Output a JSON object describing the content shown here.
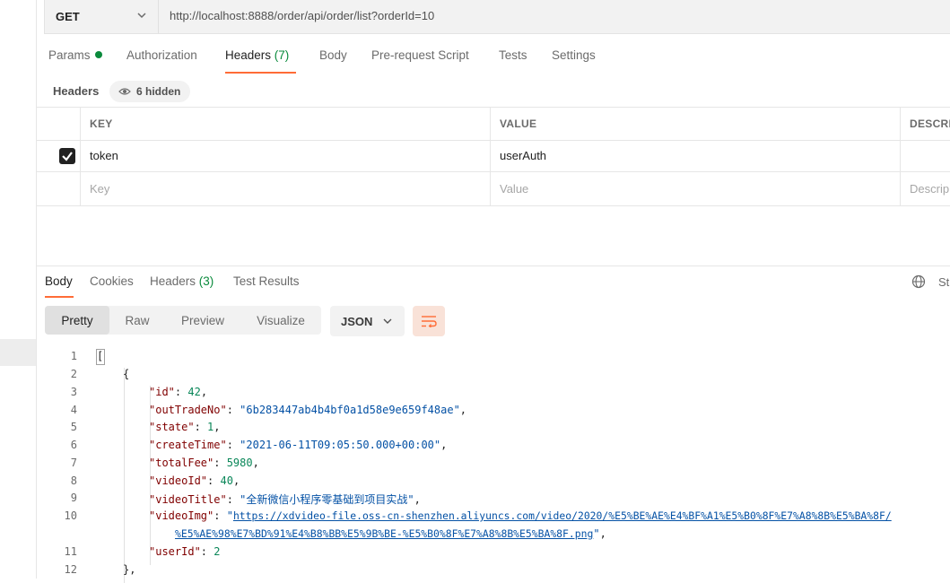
{
  "request": {
    "method": "GET",
    "url": "http://localhost:8888/order/api/order/list?orderId=10"
  },
  "request_tabs": [
    {
      "label": "Params",
      "count": ""
    },
    {
      "label": "Authorization",
      "count": ""
    },
    {
      "label": "Headers",
      "count": "(7)"
    },
    {
      "label": "Body",
      "count": ""
    },
    {
      "label": "Pre-request Script",
      "count": ""
    },
    {
      "label": "Tests",
      "count": ""
    },
    {
      "label": "Settings",
      "count": ""
    }
  ],
  "headers_section": {
    "title": "Headers",
    "hidden_label": "6 hidden"
  },
  "headers_table": {
    "columns": [
      "KEY",
      "VALUE",
      "DESCRI"
    ],
    "rows": [
      {
        "checked": true,
        "key": "token",
        "value": "userAuth",
        "description": ""
      }
    ],
    "placeholders": {
      "key": "Key",
      "value": "Value",
      "description": "Descrip"
    }
  },
  "response_tabs": [
    {
      "label": "Body",
      "count": ""
    },
    {
      "label": "Cookies",
      "count": ""
    },
    {
      "label": "Headers",
      "count": "(3)"
    },
    {
      "label": "Test Results",
      "count": ""
    }
  ],
  "status_partial": "St",
  "view_modes": [
    "Pretty",
    "Raw",
    "Preview",
    "Visualize"
  ],
  "active_view_mode": "Pretty",
  "format": "JSON",
  "code_lines": [
    {
      "n": "1",
      "text": "["
    },
    {
      "n": "2",
      "text": "{"
    },
    {
      "n": "3",
      "key": "\"id\"",
      "value": "42",
      "vtype": "num",
      "comma": ","
    },
    {
      "n": "4",
      "key": "\"outTradeNo\"",
      "value": "\"6b283447ab4b4bf0a1d58e9e659f48ae\"",
      "vtype": "str",
      "comma": ","
    },
    {
      "n": "5",
      "key": "\"state\"",
      "value": "1",
      "vtype": "num",
      "comma": ","
    },
    {
      "n": "6",
      "key": "\"createTime\"",
      "value": "\"2021-06-11T09:05:50.000+00:00\"",
      "vtype": "str",
      "comma": ","
    },
    {
      "n": "7",
      "key": "\"totalFee\"",
      "value": "5980",
      "vtype": "num",
      "comma": ","
    },
    {
      "n": "8",
      "key": "\"videoId\"",
      "value": "40",
      "vtype": "num",
      "comma": ","
    },
    {
      "n": "9",
      "key": "\"videoTitle\"",
      "value": "\"全新微信小程序零基础到项目实战\"",
      "vtype": "str",
      "comma": ","
    },
    {
      "n": "10",
      "key": "\"videoImg\"",
      "value_prefix": "\"",
      "link_part1": "https://xdvideo-file.oss-cn-shenzhen.aliyuncs.com/video/2020/%E5%BE%AE%E4%BF%A1%E5%B0%8F%E7%A8%8B%E5%BA%8F/",
      "link_part2": "%E5%AE%98%E7%BD%91%E4%B8%BB%E5%9B%BE-%E5%B0%8F%E7%A8%8B%E5%BA%8F.png",
      "value_suffix": "\"",
      "comma": ","
    },
    {
      "n": "11",
      "key": "\"userId\"",
      "value": "2",
      "vtype": "num",
      "comma": ""
    },
    {
      "n": "12",
      "text": "},"
    }
  ],
  "colors": {
    "accent": "#ff6c37",
    "success": "#0a8a3c",
    "json_key": "#800000",
    "json_string": "#0451a5",
    "json_number": "#098658"
  },
  "icons": [
    "chevron-down-icon",
    "eye-icon",
    "checkbox-checked-icon",
    "globe-icon",
    "wrap-lines-icon"
  ]
}
